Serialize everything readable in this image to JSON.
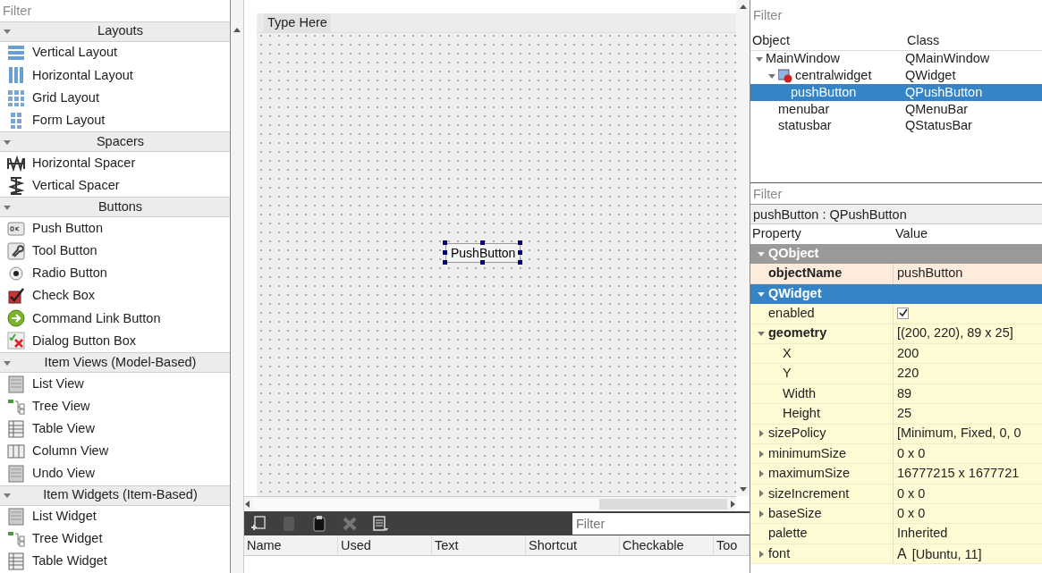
{
  "widget_box": {
    "filter": {
      "placeholder": "Filter"
    },
    "categories": [
      {
        "title": "Layouts",
        "expanded": true,
        "items": [
          "Vertical Layout",
          "Horizontal Layout",
          "Grid Layout",
          "Form Layout"
        ]
      },
      {
        "title": "Spacers",
        "expanded": true,
        "items": [
          "Horizontal Spacer",
          "Vertical Spacer"
        ]
      },
      {
        "title": "Buttons",
        "expanded": true,
        "items": [
          "Push Button",
          "Tool Button",
          "Radio Button",
          "Check Box",
          "Command Link Button",
          "Dialog Button Box"
        ]
      },
      {
        "title": "Item Views (Model-Based)",
        "expanded": true,
        "items": [
          "List View",
          "Tree View",
          "Table View",
          "Column View",
          "Undo View"
        ]
      },
      {
        "title": "Item Widgets (Item-Based)",
        "expanded": true,
        "items": [
          "List Widget",
          "Tree Widget",
          "Table Widget"
        ]
      }
    ]
  },
  "form": {
    "menu_placeholder": "Type Here",
    "widgets": [
      {
        "kind": "push_button",
        "text": "PushButton",
        "selected": true
      }
    ]
  },
  "action_editor": {
    "tools": [
      {
        "disabled": false
      },
      {
        "disabled": true
      },
      {
        "disabled": false
      },
      {
        "disabled": true
      },
      {
        "disabled": false
      }
    ],
    "filter": {
      "placeholder": "Filter"
    },
    "columns": [
      "Name",
      "Used",
      "Text",
      "Shortcut",
      "Checkable",
      "Too"
    ]
  },
  "object_inspector": {
    "filter": {
      "placeholder": "Filter"
    },
    "columns": [
      "Object",
      "Class"
    ],
    "tree": [
      {
        "object": "MainWindow",
        "class": "QMainWindow",
        "expanded": true,
        "selected": false,
        "children": [
          {
            "object": "centralwidget",
            "class": "QWidget",
            "expanded": true,
            "selected": false,
            "children": [
              {
                "object": "pushButton",
                "class": "QPushButton",
                "selected": true
              }
            ]
          },
          {
            "object": "menubar",
            "class": "QMenuBar",
            "selected": false
          },
          {
            "object": "statusbar",
            "class": "QStatusBar",
            "selected": false
          }
        ]
      }
    ]
  },
  "property_editor": {
    "filter": {
      "placeholder": "Filter"
    },
    "title": "pushButton : QPushButton",
    "columns": [
      "Property",
      "Value"
    ],
    "groups": [
      {
        "name": "QObject",
        "expanded": true,
        "selected": false,
        "color": "#fdebdc",
        "properties": [
          {
            "kind": "text",
            "name": "objectName",
            "value": "pushButton",
            "modified": true
          }
        ]
      },
      {
        "name": "QWidget",
        "expanded": true,
        "selected": true,
        "color": "#fefbd4",
        "properties": [
          {
            "kind": "check",
            "name": "enabled",
            "checked": true,
            "modified": false
          },
          {
            "kind": "text",
            "name": "geometry",
            "value": "[(200, 220), 89 x 25]",
            "modified": true,
            "expanded": true,
            "children": [
              {
                "kind": "text",
                "name": "X",
                "value": "200",
                "modified": false
              },
              {
                "kind": "text",
                "name": "Y",
                "value": "220",
                "modified": false
              },
              {
                "kind": "text",
                "name": "Width",
                "value": "89",
                "modified": false
              },
              {
                "kind": "text",
                "name": "Height",
                "value": "25",
                "modified": false
              }
            ]
          },
          {
            "kind": "text",
            "name": "sizePolicy",
            "value": "[Minimum, Fixed, 0, 0",
            "modified": false,
            "expanded": false
          },
          {
            "kind": "text",
            "name": "minimumSize",
            "value": "0 x 0",
            "modified": false,
            "expanded": false
          },
          {
            "kind": "text",
            "name": "maximumSize",
            "value": "16777215 x 1677721",
            "modified": false,
            "expanded": false
          },
          {
            "kind": "text",
            "name": "sizeIncrement",
            "value": "0 x 0",
            "modified": false,
            "expanded": false
          },
          {
            "kind": "text",
            "name": "baseSize",
            "value": "0 x 0",
            "modified": false,
            "expanded": false
          },
          {
            "kind": "text",
            "name": "palette",
            "value": "Inherited",
            "modified": false
          },
          {
            "kind": "font",
            "name": "font",
            "sample": "A",
            "value": "[Ubuntu, 11]",
            "modified": false,
            "expanded": false
          }
        ]
      }
    ]
  }
}
